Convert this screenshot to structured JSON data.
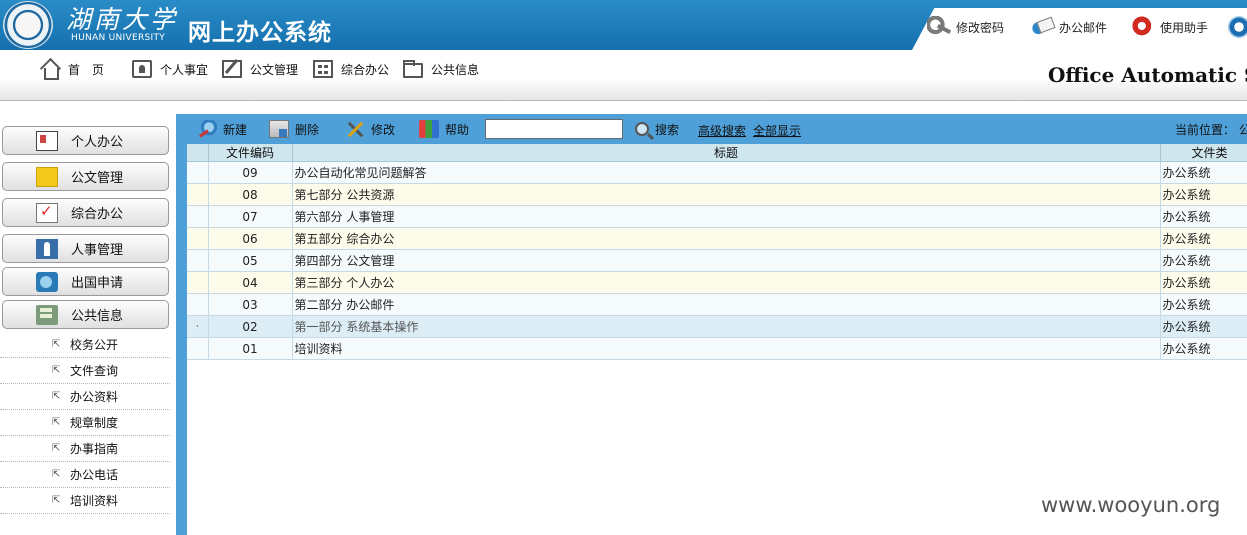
{
  "banner": {
    "university_cn": "湖南大学",
    "university_en": "HUNAN UNIVERSITY",
    "system_title": "网上办公系统",
    "tools": [
      {
        "label": "修改密码",
        "icon": "key-icon"
      },
      {
        "label": "办公邮件",
        "icon": "mail-icon"
      },
      {
        "label": "使用助手",
        "icon": "help-icon"
      }
    ]
  },
  "topnav": {
    "items": [
      {
        "label": "首　页",
        "icon": "home-icon"
      },
      {
        "label": "个人事宜",
        "icon": "contact-card-icon"
      },
      {
        "label": "公文管理",
        "icon": "edit-document-icon"
      },
      {
        "label": "综合办公",
        "icon": "grid-icon"
      },
      {
        "label": "公共信息",
        "icon": "folder-icon"
      }
    ],
    "tagline": "Office Automatic S"
  },
  "sidebar": {
    "menus": [
      {
        "label": "个人办公",
        "icon": "personal-office-icon"
      },
      {
        "label": "公文管理",
        "icon": "document-icon"
      },
      {
        "label": "综合办公",
        "icon": "checklist-icon"
      },
      {
        "label": "人事管理",
        "icon": "person-icon"
      },
      {
        "label": "出国申请",
        "icon": "globe-icon"
      },
      {
        "label": "公共信息",
        "icon": "public-info-icon"
      }
    ],
    "submenu": [
      "校务公开",
      "文件查询",
      "办公资料",
      "规章制度",
      "办事指南",
      "办公电话",
      "培训资料"
    ]
  },
  "toolbar": {
    "new_label": "新建",
    "delete_label": "删除",
    "edit_label": "修改",
    "help_label": "帮助",
    "search_value": "",
    "search_label": "搜索",
    "advanced_search_label": "高级搜索",
    "show_all_label": "全部显示",
    "location_label": "当前位置：",
    "location_value": "公"
  },
  "table": {
    "columns": [
      "",
      "文件编码",
      "标题",
      "文件类"
    ],
    "rows": [
      {
        "code": "09",
        "title": "办公自动化常见问题解答",
        "type": "办公系统"
      },
      {
        "code": "08",
        "title": "第七部分 公共资源",
        "type": "办公系统"
      },
      {
        "code": "07",
        "title": "第六部分 人事管理",
        "type": "办公系统"
      },
      {
        "code": "06",
        "title": "第五部分 综合办公",
        "type": "办公系统"
      },
      {
        "code": "05",
        "title": "第四部分 公文管理",
        "type": "办公系统"
      },
      {
        "code": "04",
        "title": "第三部分 个人办公",
        "type": "办公系统"
      },
      {
        "code": "03",
        "title": "第二部分 办公邮件",
        "type": "办公系统"
      },
      {
        "code": "02",
        "title": "第一部分 系统基本操作",
        "type": "办公系统",
        "marker": "·"
      },
      {
        "code": "01",
        "title": "培训资料",
        "type": "办公系统"
      }
    ],
    "selected_row_index": 7
  },
  "watermark": "www.wooyun.org"
}
